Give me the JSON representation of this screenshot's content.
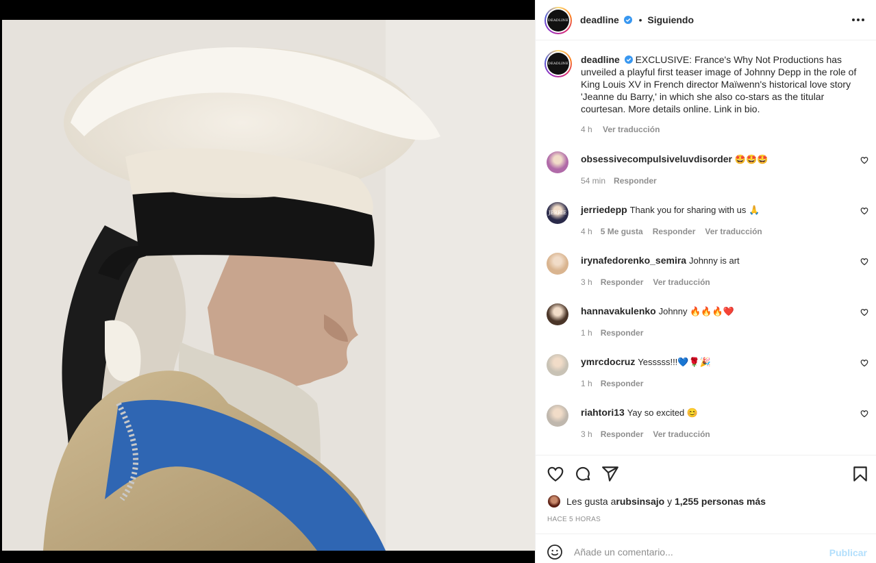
{
  "post": {
    "username": "deadline",
    "follow_status": "Siguiendo",
    "avatar_text": "DEADLINE",
    "caption": "EXCLUSIVE: France's Why Not Productions has unveiled a playful first teaser image of Johnny Depp in the role of King Louis XV in French director Maïwenn's historical love story 'Jeanne du Barry,' in which she also co-stars as the titular courtesan. More details online. Link in bio.",
    "caption_time": "4 h",
    "caption_translate": "Ver traducción"
  },
  "comments": [
    {
      "user": "obsessivecompulsiveluvdisorder",
      "text": "🤩🤩🤩",
      "time": "54 min",
      "likes": "",
      "reply": "Responder",
      "translate": "",
      "avatar_color": "#b06aa8"
    },
    {
      "user": "jerriedepp",
      "text": "Thank you for sharing with us 🙏",
      "time": "4 h",
      "likes": "5 Me gusta",
      "reply": "Responder",
      "translate": "Ver traducción",
      "avatar_color": "#2a2a4a",
      "avatar_text": "JERRIE"
    },
    {
      "user": "irynafedorenko_semira",
      "text": "Johnny is art",
      "time": "3 h",
      "likes": "",
      "reply": "Responder",
      "translate": "Ver traducción",
      "avatar_color": "#d9b48f"
    },
    {
      "user": "hannavakulenko",
      "text": "Johnny 🔥🔥🔥❤️",
      "time": "1 h",
      "likes": "",
      "reply": "Responder",
      "translate": "",
      "avatar_color": "#4a3528"
    },
    {
      "user": "ymrcdocruz",
      "text": "Yesssss!!!💙🌹🎉",
      "time": "1 h",
      "likes": "",
      "reply": "Responder",
      "translate": "",
      "avatar_color": "#c8c2b5"
    },
    {
      "user": "riahtori13",
      "text": "Yay so excited 😊",
      "time": "3 h",
      "likes": "",
      "reply": "Responder",
      "translate": "Ver traducción",
      "avatar_color": "#bfb7ad"
    }
  ],
  "likes": {
    "prefix": "Les gusta a ",
    "user": "rubsinsajo",
    "middle": " y ",
    "others": "1,255 personas más"
  },
  "timestamp": "HACE 5 HORAS",
  "composer": {
    "placeholder": "Añade un comentario...",
    "publish": "Publicar"
  },
  "icons": [
    "more-icon",
    "verified-icon",
    "heart-icon",
    "comment-icon",
    "share-icon",
    "bookmark-icon",
    "emoji-icon"
  ],
  "colors": {
    "accent": "#0095f6",
    "publish_disabled": "#b2dffc",
    "muted": "#8e8e8e",
    "verified": "#3897f0"
  }
}
